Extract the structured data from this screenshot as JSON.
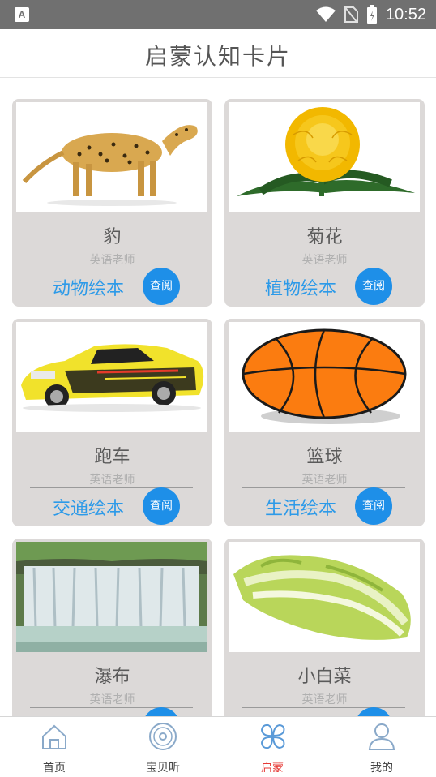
{
  "status_bar": {
    "time": "10:52",
    "notification_icon": "A"
  },
  "header": {
    "title": "启蒙认知卡片"
  },
  "cards": [
    {
      "title": "豹",
      "author": "英语老师",
      "category": "动物绘本",
      "button": "查阅",
      "image": "cheetah"
    },
    {
      "title": "菊花",
      "author": "英语老师",
      "category": "植物绘本",
      "button": "查阅",
      "image": "chrysanthemum"
    },
    {
      "title": "跑车",
      "author": "英语老师",
      "category": "交通绘本",
      "button": "查阅",
      "image": "sports-car"
    },
    {
      "title": "篮球",
      "author": "英语老师",
      "category": "生活绘本",
      "button": "查阅",
      "image": "basketball"
    },
    {
      "title": "瀑布",
      "author": "英语老师",
      "category": "",
      "button": "",
      "image": "waterfall"
    },
    {
      "title": "小白菜",
      "author": "英语老师",
      "category": "",
      "button": "",
      "image": "cabbage"
    }
  ],
  "bottom_nav": {
    "items": [
      {
        "label": "首页",
        "icon": "home-icon"
      },
      {
        "label": "宝贝听",
        "icon": "disc-icon"
      },
      {
        "label": "启蒙",
        "icon": "clover-icon",
        "active": true
      },
      {
        "label": "我的",
        "icon": "person-icon"
      }
    ]
  },
  "colors": {
    "accent": "#2d9ae8",
    "button": "#1e8fe8",
    "active_nav": "#e53935",
    "card_bg": "#dcd9d8"
  }
}
